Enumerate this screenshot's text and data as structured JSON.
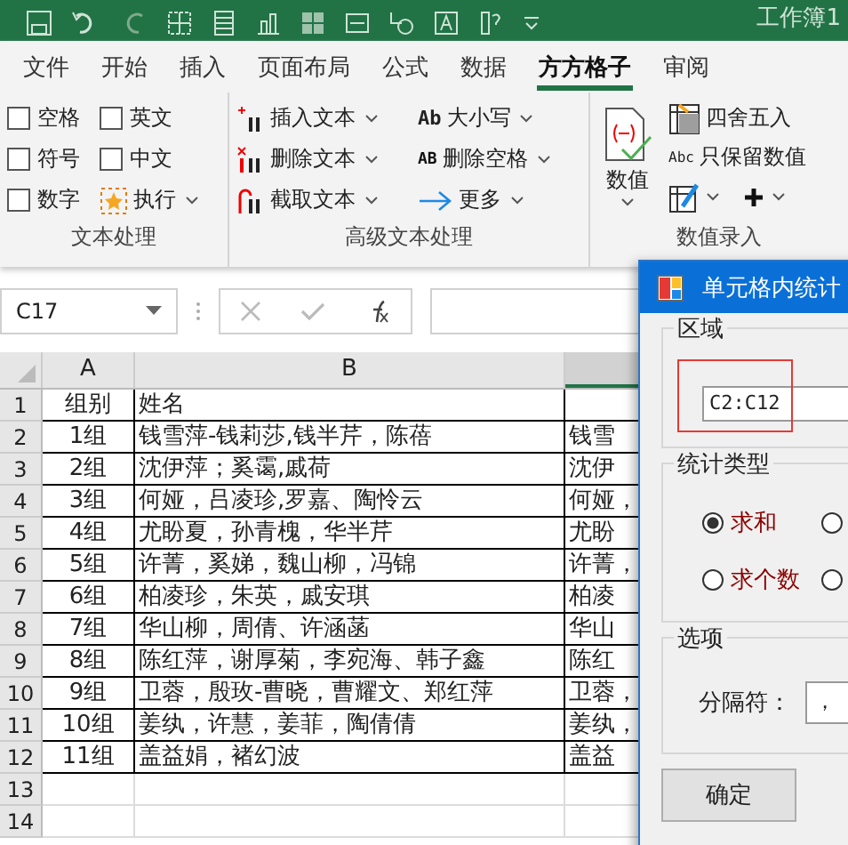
{
  "title_bar": {
    "title": "工作簿1"
  },
  "tabs": [
    {
      "label": "文件",
      "selected": false
    },
    {
      "label": "开始",
      "selected": false
    },
    {
      "label": "插入",
      "selected": false
    },
    {
      "label": "页面布局",
      "selected": false
    },
    {
      "label": "公式",
      "selected": false
    },
    {
      "label": "数据",
      "selected": false
    },
    {
      "label": "方方格子",
      "selected": true
    },
    {
      "label": "审阅",
      "selected": false
    }
  ],
  "ribbon": {
    "text_group": {
      "label": "文本处理",
      "checkboxes": [
        {
          "label": "空格",
          "checked": false
        },
        {
          "label": "英文",
          "checked": false
        },
        {
          "label": "符号",
          "checked": false
        },
        {
          "label": "中文",
          "checked": false
        },
        {
          "label": "数字",
          "checked": false
        }
      ],
      "run_button": "执行"
    },
    "advanced_group": {
      "label": "高级文本处理",
      "buttons": [
        {
          "kind": "insert",
          "label": "插入文本"
        },
        {
          "kind": "case",
          "label": "大小写",
          "icon_text": "Ab"
        },
        {
          "kind": "delete",
          "label": "删除文本"
        },
        {
          "kind": "trim",
          "label": "删除空格",
          "icon_text": "AB"
        },
        {
          "kind": "extract",
          "label": "截取文本"
        },
        {
          "kind": "more",
          "label": "更多"
        }
      ]
    },
    "number_group": {
      "label": "数值录入",
      "big_button": "数值",
      "buttons": [
        {
          "kind": "round",
          "label": "四舍五入"
        },
        {
          "kind": "keep",
          "label": "只保留数值",
          "icon_text": "Abc"
        }
      ]
    }
  },
  "formula_bar": {
    "name_box": "C17"
  },
  "sheet": {
    "columns": [
      {
        "label": "A",
        "selected": false
      },
      {
        "label": "B",
        "selected": false
      },
      {
        "selected": true
      }
    ],
    "rows": [
      {
        "number": "1",
        "cells": [
          "组别",
          "姓名"
        ]
      },
      {
        "number": "2",
        "cells": [
          "1组",
          "钱雪萍-钱莉莎,钱半芹，陈蓓",
          "钱雪"
        ]
      },
      {
        "number": "3",
        "cells": [
          "2组",
          "沈伊萍；奚霭,戚荷",
          "沈伊"
        ]
      },
      {
        "number": "4",
        "cells": [
          "3组",
          "何娅，吕凌珍,罗嘉、陶怜云",
          "何娅，"
        ]
      },
      {
        "number": "5",
        "cells": [
          "4组",
          "尤盼夏，孙青槐，华半芹",
          "尤盼"
        ]
      },
      {
        "number": "6",
        "cells": [
          "5组",
          "许菁，奚娣，魏山柳，冯锦",
          "许菁，"
        ]
      },
      {
        "number": "7",
        "cells": [
          "6组",
          "柏凌珍，朱英，戚安琪",
          "柏凌"
        ]
      },
      {
        "number": "8",
        "cells": [
          "7组",
          "华山柳，周倩、许涵菡",
          "华山"
        ]
      },
      {
        "number": "9",
        "cells": [
          "8组",
          "陈红萍，谢厚菊，李宛海、韩子鑫",
          "陈红"
        ]
      },
      {
        "number": "10",
        "cells": [
          "9组",
          "卫蓉，殷玫-曹晓，曹耀文、郑红萍",
          "卫蓉，"
        ]
      },
      {
        "number": "11",
        "cells": [
          "10组",
          "姜纨，许慧，姜菲，陶倩倩",
          "姜纨，"
        ]
      },
      {
        "number": "12",
        "cells": [
          "11组",
          "盖益娟，褚幻波",
          "盖益"
        ]
      },
      {
        "number": "13",
        "cells": []
      },
      {
        "number": "14",
        "cells": []
      }
    ]
  },
  "dialog": {
    "title": "单元格内统计",
    "region": {
      "legend": "区域",
      "value": "C2:C12"
    },
    "stat_type": {
      "legend": "统计类型",
      "options": [
        {
          "label": "求和",
          "selected": true
        },
        {
          "selected": false
        },
        {
          "label": "求个数",
          "selected": false
        },
        {
          "selected": false
        }
      ]
    },
    "options": {
      "legend": "选项",
      "separator_label": "分隔符：",
      "separator_value": "，"
    },
    "ok_button": "确定"
  }
}
